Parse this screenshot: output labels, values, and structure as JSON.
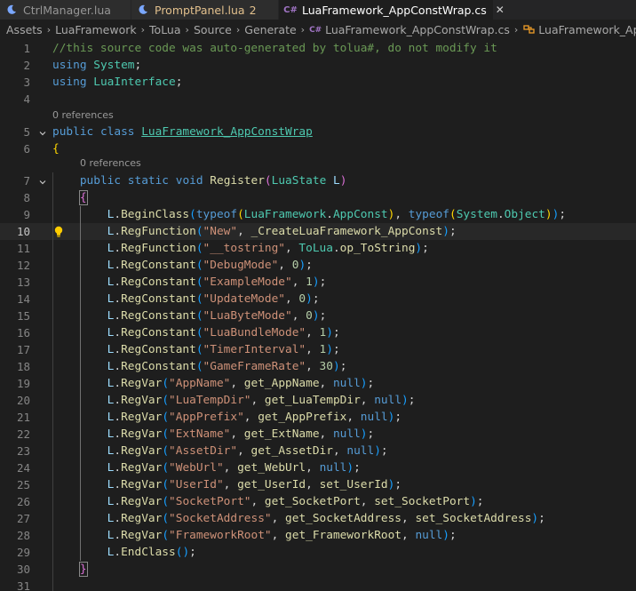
{
  "tabs": [
    {
      "label": "CtrlManager.lua",
      "icon": "moon-icon",
      "active": false,
      "badge": "",
      "warn": false,
      "close": ""
    },
    {
      "label": "PromptPanel.lua",
      "icon": "moon-icon",
      "active": false,
      "badge": "2",
      "warn": true,
      "close": ""
    },
    {
      "label": "LuaFramework_AppConstWrap.cs",
      "icon": "csharp-icon",
      "active": true,
      "badge": "",
      "warn": false,
      "close": "✕"
    }
  ],
  "breadcrumb": {
    "items": [
      "Assets",
      "LuaFramework",
      "ToLua",
      "Source",
      "Generate"
    ],
    "file": "LuaFramework_AppConstWrap.cs",
    "symbol": "LuaFramework_AppCon"
  },
  "codelens": {
    "class_refs": "0 references",
    "method_refs": "0 references"
  },
  "editor": {
    "current_line": 10
  },
  "lines": [
    {
      "n": "1",
      "t": [
        [
          "c-com",
          "//this source code was auto-generated by tolua#, do not modify it"
        ]
      ]
    },
    {
      "n": "2",
      "t": [
        [
          "c-kw",
          "using"
        ],
        [
          "c-pun",
          " "
        ],
        [
          "c-type",
          "System"
        ],
        [
          "c-pun",
          ";"
        ]
      ]
    },
    {
      "n": "3",
      "t": [
        [
          "c-kw",
          "using"
        ],
        [
          "c-pun",
          " "
        ],
        [
          "c-type",
          "LuaInterface"
        ],
        [
          "c-pun",
          ";"
        ]
      ]
    },
    {
      "n": "4",
      "t": []
    },
    {
      "n": "5",
      "t": [
        [
          "c-kw",
          "public"
        ],
        [
          "c-pun",
          " "
        ],
        [
          "c-kw",
          "class"
        ],
        [
          "c-pun",
          " "
        ],
        [
          "c-type ul",
          "LuaFramework_AppConstWrap"
        ]
      ]
    },
    {
      "n": "6",
      "t": [
        [
          "c-br1",
          "{"
        ]
      ]
    },
    {
      "n": "7",
      "t": [
        [
          "c-pun",
          "    "
        ],
        [
          "c-kw",
          "public"
        ],
        [
          "c-pun",
          " "
        ],
        [
          "c-kw",
          "static"
        ],
        [
          "c-pun",
          " "
        ],
        [
          "c-kw",
          "void"
        ],
        [
          "c-pun",
          " "
        ],
        [
          "c-fn",
          "Register"
        ],
        [
          "c-br2",
          "("
        ],
        [
          "c-type",
          "LuaState"
        ],
        [
          "c-pun",
          " "
        ],
        [
          "c-var",
          "L"
        ],
        [
          "c-br2",
          ")"
        ]
      ]
    },
    {
      "n": "8",
      "t": [
        [
          "c-pun",
          "    "
        ],
        [
          "c-br2 bm",
          "{"
        ]
      ]
    },
    {
      "n": "9",
      "t": [
        [
          "c-pun",
          "        "
        ],
        [
          "c-var",
          "L"
        ],
        [
          "c-pun",
          "."
        ],
        [
          "c-fn",
          "BeginClass"
        ],
        [
          "c-br3",
          "("
        ],
        [
          "c-kw",
          "typeof"
        ],
        [
          "c-br1",
          "("
        ],
        [
          "c-type",
          "LuaFramework"
        ],
        [
          "c-pun",
          "."
        ],
        [
          "c-type",
          "AppConst"
        ],
        [
          "c-br1",
          ")"
        ],
        [
          "c-pun",
          ", "
        ],
        [
          "c-kw",
          "typeof"
        ],
        [
          "c-br1",
          "("
        ],
        [
          "c-type",
          "System"
        ],
        [
          "c-pun",
          "."
        ],
        [
          "c-type",
          "Object"
        ],
        [
          "c-br1",
          ")"
        ],
        [
          "c-br3",
          ")"
        ],
        [
          "c-pun",
          ";"
        ]
      ]
    },
    {
      "n": "10",
      "t": [
        [
          "c-pun",
          "        "
        ],
        [
          "c-var",
          "L"
        ],
        [
          "c-pun",
          "."
        ],
        [
          "c-fn",
          "RegFunction"
        ],
        [
          "c-br3",
          "("
        ],
        [
          "c-str",
          "\"New\""
        ],
        [
          "c-pun",
          ", "
        ],
        [
          "c-fn",
          "_CreateLuaFramework_AppConst"
        ],
        [
          "c-br3",
          ")"
        ],
        [
          "c-pun",
          ";"
        ]
      ]
    },
    {
      "n": "11",
      "t": [
        [
          "c-pun",
          "        "
        ],
        [
          "c-var",
          "L"
        ],
        [
          "c-pun",
          "."
        ],
        [
          "c-fn",
          "RegFunction"
        ],
        [
          "c-br3",
          "("
        ],
        [
          "c-str",
          "\"__tostring\""
        ],
        [
          "c-pun",
          ", "
        ],
        [
          "c-type",
          "ToLua"
        ],
        [
          "c-pun",
          "."
        ],
        [
          "c-fn",
          "op_ToString"
        ],
        [
          "c-br3",
          ")"
        ],
        [
          "c-pun",
          ";"
        ]
      ]
    },
    {
      "n": "12",
      "t": [
        [
          "c-pun",
          "        "
        ],
        [
          "c-var",
          "L"
        ],
        [
          "c-pun",
          "."
        ],
        [
          "c-fn",
          "RegConstant"
        ],
        [
          "c-br3",
          "("
        ],
        [
          "c-str",
          "\"DebugMode\""
        ],
        [
          "c-pun",
          ", "
        ],
        [
          "c-num",
          "0"
        ],
        [
          "c-br3",
          ")"
        ],
        [
          "c-pun",
          ";"
        ]
      ]
    },
    {
      "n": "13",
      "t": [
        [
          "c-pun",
          "        "
        ],
        [
          "c-var",
          "L"
        ],
        [
          "c-pun",
          "."
        ],
        [
          "c-fn",
          "RegConstant"
        ],
        [
          "c-br3",
          "("
        ],
        [
          "c-str",
          "\"ExampleMode\""
        ],
        [
          "c-pun",
          ", "
        ],
        [
          "c-num",
          "1"
        ],
        [
          "c-br3",
          ")"
        ],
        [
          "c-pun",
          ";"
        ]
      ]
    },
    {
      "n": "14",
      "t": [
        [
          "c-pun",
          "        "
        ],
        [
          "c-var",
          "L"
        ],
        [
          "c-pun",
          "."
        ],
        [
          "c-fn",
          "RegConstant"
        ],
        [
          "c-br3",
          "("
        ],
        [
          "c-str",
          "\"UpdateMode\""
        ],
        [
          "c-pun",
          ", "
        ],
        [
          "c-num",
          "0"
        ],
        [
          "c-br3",
          ")"
        ],
        [
          "c-pun",
          ";"
        ]
      ]
    },
    {
      "n": "15",
      "t": [
        [
          "c-pun",
          "        "
        ],
        [
          "c-var",
          "L"
        ],
        [
          "c-pun",
          "."
        ],
        [
          "c-fn",
          "RegConstant"
        ],
        [
          "c-br3",
          "("
        ],
        [
          "c-str",
          "\"LuaByteMode\""
        ],
        [
          "c-pun",
          ", "
        ],
        [
          "c-num",
          "0"
        ],
        [
          "c-br3",
          ")"
        ],
        [
          "c-pun",
          ";"
        ]
      ]
    },
    {
      "n": "16",
      "t": [
        [
          "c-pun",
          "        "
        ],
        [
          "c-var",
          "L"
        ],
        [
          "c-pun",
          "."
        ],
        [
          "c-fn",
          "RegConstant"
        ],
        [
          "c-br3",
          "("
        ],
        [
          "c-str",
          "\"LuaBundleMode\""
        ],
        [
          "c-pun",
          ", "
        ],
        [
          "c-num",
          "1"
        ],
        [
          "c-br3",
          ")"
        ],
        [
          "c-pun",
          ";"
        ]
      ]
    },
    {
      "n": "17",
      "t": [
        [
          "c-pun",
          "        "
        ],
        [
          "c-var",
          "L"
        ],
        [
          "c-pun",
          "."
        ],
        [
          "c-fn",
          "RegConstant"
        ],
        [
          "c-br3",
          "("
        ],
        [
          "c-str",
          "\"TimerInterval\""
        ],
        [
          "c-pun",
          ", "
        ],
        [
          "c-num",
          "1"
        ],
        [
          "c-br3",
          ")"
        ],
        [
          "c-pun",
          ";"
        ]
      ]
    },
    {
      "n": "18",
      "t": [
        [
          "c-pun",
          "        "
        ],
        [
          "c-var",
          "L"
        ],
        [
          "c-pun",
          "."
        ],
        [
          "c-fn",
          "RegConstant"
        ],
        [
          "c-br3",
          "("
        ],
        [
          "c-str",
          "\"GameFrameRate\""
        ],
        [
          "c-pun",
          ", "
        ],
        [
          "c-num",
          "30"
        ],
        [
          "c-br3",
          ")"
        ],
        [
          "c-pun",
          ";"
        ]
      ]
    },
    {
      "n": "19",
      "t": [
        [
          "c-pun",
          "        "
        ],
        [
          "c-var",
          "L"
        ],
        [
          "c-pun",
          "."
        ],
        [
          "c-fn",
          "RegVar"
        ],
        [
          "c-br3",
          "("
        ],
        [
          "c-str",
          "\"AppName\""
        ],
        [
          "c-pun",
          ", "
        ],
        [
          "c-fn",
          "get_AppName"
        ],
        [
          "c-pun",
          ", "
        ],
        [
          "c-kw",
          "null"
        ],
        [
          "c-br3",
          ")"
        ],
        [
          "c-pun",
          ";"
        ]
      ]
    },
    {
      "n": "20",
      "t": [
        [
          "c-pun",
          "        "
        ],
        [
          "c-var",
          "L"
        ],
        [
          "c-pun",
          "."
        ],
        [
          "c-fn",
          "RegVar"
        ],
        [
          "c-br3",
          "("
        ],
        [
          "c-str",
          "\"LuaTempDir\""
        ],
        [
          "c-pun",
          ", "
        ],
        [
          "c-fn",
          "get_LuaTempDir"
        ],
        [
          "c-pun",
          ", "
        ],
        [
          "c-kw",
          "null"
        ],
        [
          "c-br3",
          ")"
        ],
        [
          "c-pun",
          ";"
        ]
      ]
    },
    {
      "n": "21",
      "t": [
        [
          "c-pun",
          "        "
        ],
        [
          "c-var",
          "L"
        ],
        [
          "c-pun",
          "."
        ],
        [
          "c-fn",
          "RegVar"
        ],
        [
          "c-br3",
          "("
        ],
        [
          "c-str",
          "\"AppPrefix\""
        ],
        [
          "c-pun",
          ", "
        ],
        [
          "c-fn",
          "get_AppPrefix"
        ],
        [
          "c-pun",
          ", "
        ],
        [
          "c-kw",
          "null"
        ],
        [
          "c-br3",
          ")"
        ],
        [
          "c-pun",
          ";"
        ]
      ]
    },
    {
      "n": "22",
      "t": [
        [
          "c-pun",
          "        "
        ],
        [
          "c-var",
          "L"
        ],
        [
          "c-pun",
          "."
        ],
        [
          "c-fn",
          "RegVar"
        ],
        [
          "c-br3",
          "("
        ],
        [
          "c-str",
          "\"ExtName\""
        ],
        [
          "c-pun",
          ", "
        ],
        [
          "c-fn",
          "get_ExtName"
        ],
        [
          "c-pun",
          ", "
        ],
        [
          "c-kw",
          "null"
        ],
        [
          "c-br3",
          ")"
        ],
        [
          "c-pun",
          ";"
        ]
      ]
    },
    {
      "n": "23",
      "t": [
        [
          "c-pun",
          "        "
        ],
        [
          "c-var",
          "L"
        ],
        [
          "c-pun",
          "."
        ],
        [
          "c-fn",
          "RegVar"
        ],
        [
          "c-br3",
          "("
        ],
        [
          "c-str",
          "\"AssetDir\""
        ],
        [
          "c-pun",
          ", "
        ],
        [
          "c-fn",
          "get_AssetDir"
        ],
        [
          "c-pun",
          ", "
        ],
        [
          "c-kw",
          "null"
        ],
        [
          "c-br3",
          ")"
        ],
        [
          "c-pun",
          ";"
        ]
      ]
    },
    {
      "n": "24",
      "t": [
        [
          "c-pun",
          "        "
        ],
        [
          "c-var",
          "L"
        ],
        [
          "c-pun",
          "."
        ],
        [
          "c-fn",
          "RegVar"
        ],
        [
          "c-br3",
          "("
        ],
        [
          "c-str",
          "\"WebUrl\""
        ],
        [
          "c-pun",
          ", "
        ],
        [
          "c-fn",
          "get_WebUrl"
        ],
        [
          "c-pun",
          ", "
        ],
        [
          "c-kw",
          "null"
        ],
        [
          "c-br3",
          ")"
        ],
        [
          "c-pun",
          ";"
        ]
      ]
    },
    {
      "n": "25",
      "t": [
        [
          "c-pun",
          "        "
        ],
        [
          "c-var",
          "L"
        ],
        [
          "c-pun",
          "."
        ],
        [
          "c-fn",
          "RegVar"
        ],
        [
          "c-br3",
          "("
        ],
        [
          "c-str",
          "\"UserId\""
        ],
        [
          "c-pun",
          ", "
        ],
        [
          "c-fn",
          "get_UserId"
        ],
        [
          "c-pun",
          ", "
        ],
        [
          "c-fn",
          "set_UserId"
        ],
        [
          "c-br3",
          ")"
        ],
        [
          "c-pun",
          ";"
        ]
      ]
    },
    {
      "n": "26",
      "t": [
        [
          "c-pun",
          "        "
        ],
        [
          "c-var",
          "L"
        ],
        [
          "c-pun",
          "."
        ],
        [
          "c-fn",
          "RegVar"
        ],
        [
          "c-br3",
          "("
        ],
        [
          "c-str",
          "\"SocketPort\""
        ],
        [
          "c-pun",
          ", "
        ],
        [
          "c-fn",
          "get_SocketPort"
        ],
        [
          "c-pun",
          ", "
        ],
        [
          "c-fn",
          "set_SocketPort"
        ],
        [
          "c-br3",
          ")"
        ],
        [
          "c-pun",
          ";"
        ]
      ]
    },
    {
      "n": "27",
      "t": [
        [
          "c-pun",
          "        "
        ],
        [
          "c-var",
          "L"
        ],
        [
          "c-pun",
          "."
        ],
        [
          "c-fn",
          "RegVar"
        ],
        [
          "c-br3",
          "("
        ],
        [
          "c-str",
          "\"SocketAddress\""
        ],
        [
          "c-pun",
          ", "
        ],
        [
          "c-fn",
          "get_SocketAddress"
        ],
        [
          "c-pun",
          ", "
        ],
        [
          "c-fn",
          "set_SocketAddress"
        ],
        [
          "c-br3",
          ")"
        ],
        [
          "c-pun",
          ";"
        ]
      ]
    },
    {
      "n": "28",
      "t": [
        [
          "c-pun",
          "        "
        ],
        [
          "c-var",
          "L"
        ],
        [
          "c-pun",
          "."
        ],
        [
          "c-fn",
          "RegVar"
        ],
        [
          "c-br3",
          "("
        ],
        [
          "c-str",
          "\"FrameworkRoot\""
        ],
        [
          "c-pun",
          ", "
        ],
        [
          "c-fn",
          "get_FrameworkRoot"
        ],
        [
          "c-pun",
          ", "
        ],
        [
          "c-kw",
          "null"
        ],
        [
          "c-br3",
          ")"
        ],
        [
          "c-pun",
          ";"
        ]
      ]
    },
    {
      "n": "29",
      "t": [
        [
          "c-pun",
          "        "
        ],
        [
          "c-var",
          "L"
        ],
        [
          "c-pun",
          "."
        ],
        [
          "c-fn",
          "EndClass"
        ],
        [
          "c-br3",
          "("
        ],
        [
          "c-br3",
          ")"
        ],
        [
          "c-pun",
          ";"
        ]
      ]
    },
    {
      "n": "30",
      "t": [
        [
          "c-pun",
          "    "
        ],
        [
          "c-br2 bm",
          "}"
        ]
      ]
    },
    {
      "n": "31",
      "t": []
    }
  ]
}
